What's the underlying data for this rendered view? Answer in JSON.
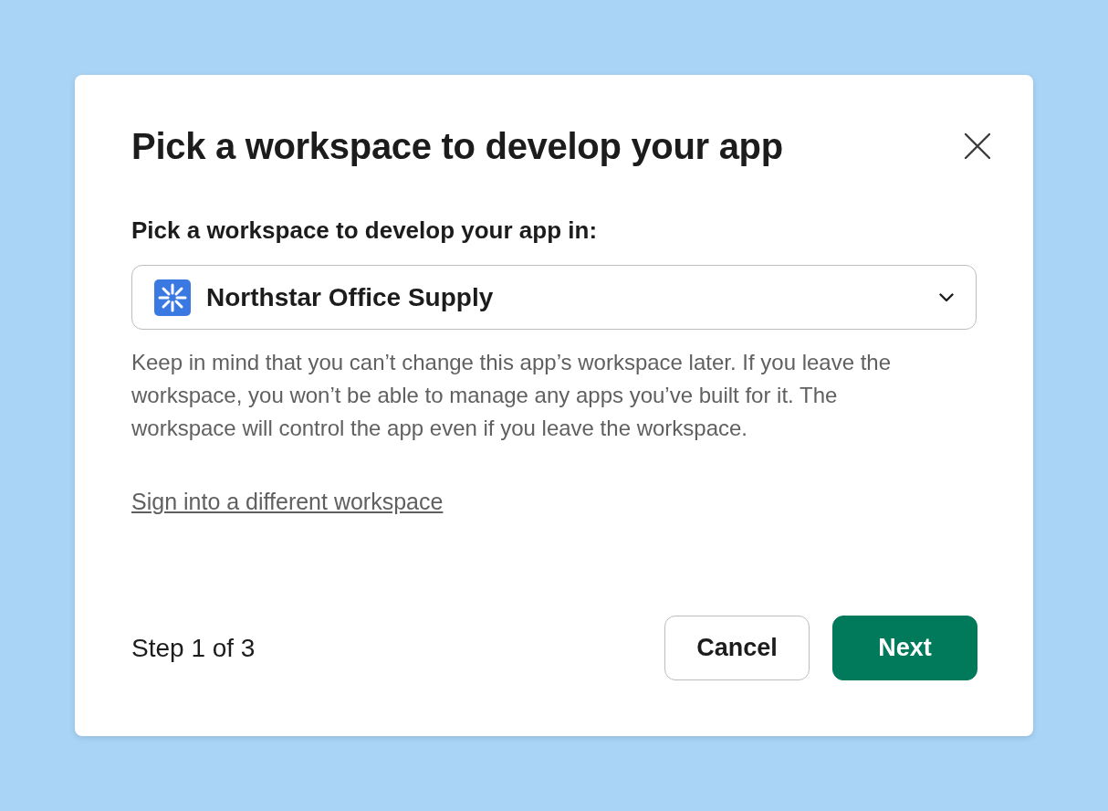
{
  "dialog": {
    "title": "Pick a workspace to develop your app",
    "field": {
      "label": "Pick a workspace to develop your app in:",
      "value": "Northstar Office Supply"
    },
    "help_text": "Keep in mind that you can’t change this app’s workspace later. If you leave the workspace, you won’t be able to manage any apps you’ve built for it. The workspace will control the app even if you leave the workspace.",
    "link": "Sign into a different workspace",
    "footer": {
      "step": "Step 1 of 3",
      "buttons": [
        {
          "label": "Cancel",
          "kind": "secondary"
        },
        {
          "label": "Next",
          "kind": "primary"
        }
      ]
    }
  }
}
